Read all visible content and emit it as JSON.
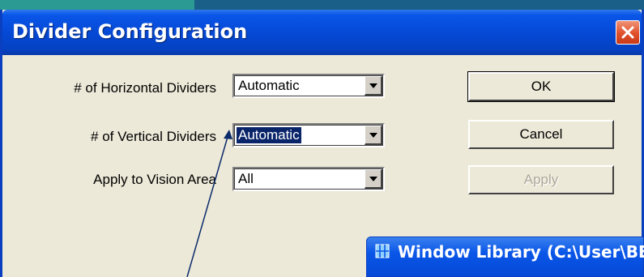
{
  "dialog": {
    "title": "Divider Configuration",
    "fields": [
      {
        "label": "# of Horizontal Dividers",
        "value": "Automatic"
      },
      {
        "label": "# of Vertical Dividers",
        "value": "Automatic"
      },
      {
        "label": "Apply to Vision Area",
        "value": "All"
      }
    ],
    "buttons": {
      "ok": "OK",
      "cancel": "Cancel",
      "apply": "Apply"
    }
  },
  "background_window": {
    "title": "Window Library (C:\\User\\BE"
  },
  "colors": {
    "titlebar": "#0549d6",
    "selection": "#0a246a",
    "desktop": "#1f8a84"
  }
}
